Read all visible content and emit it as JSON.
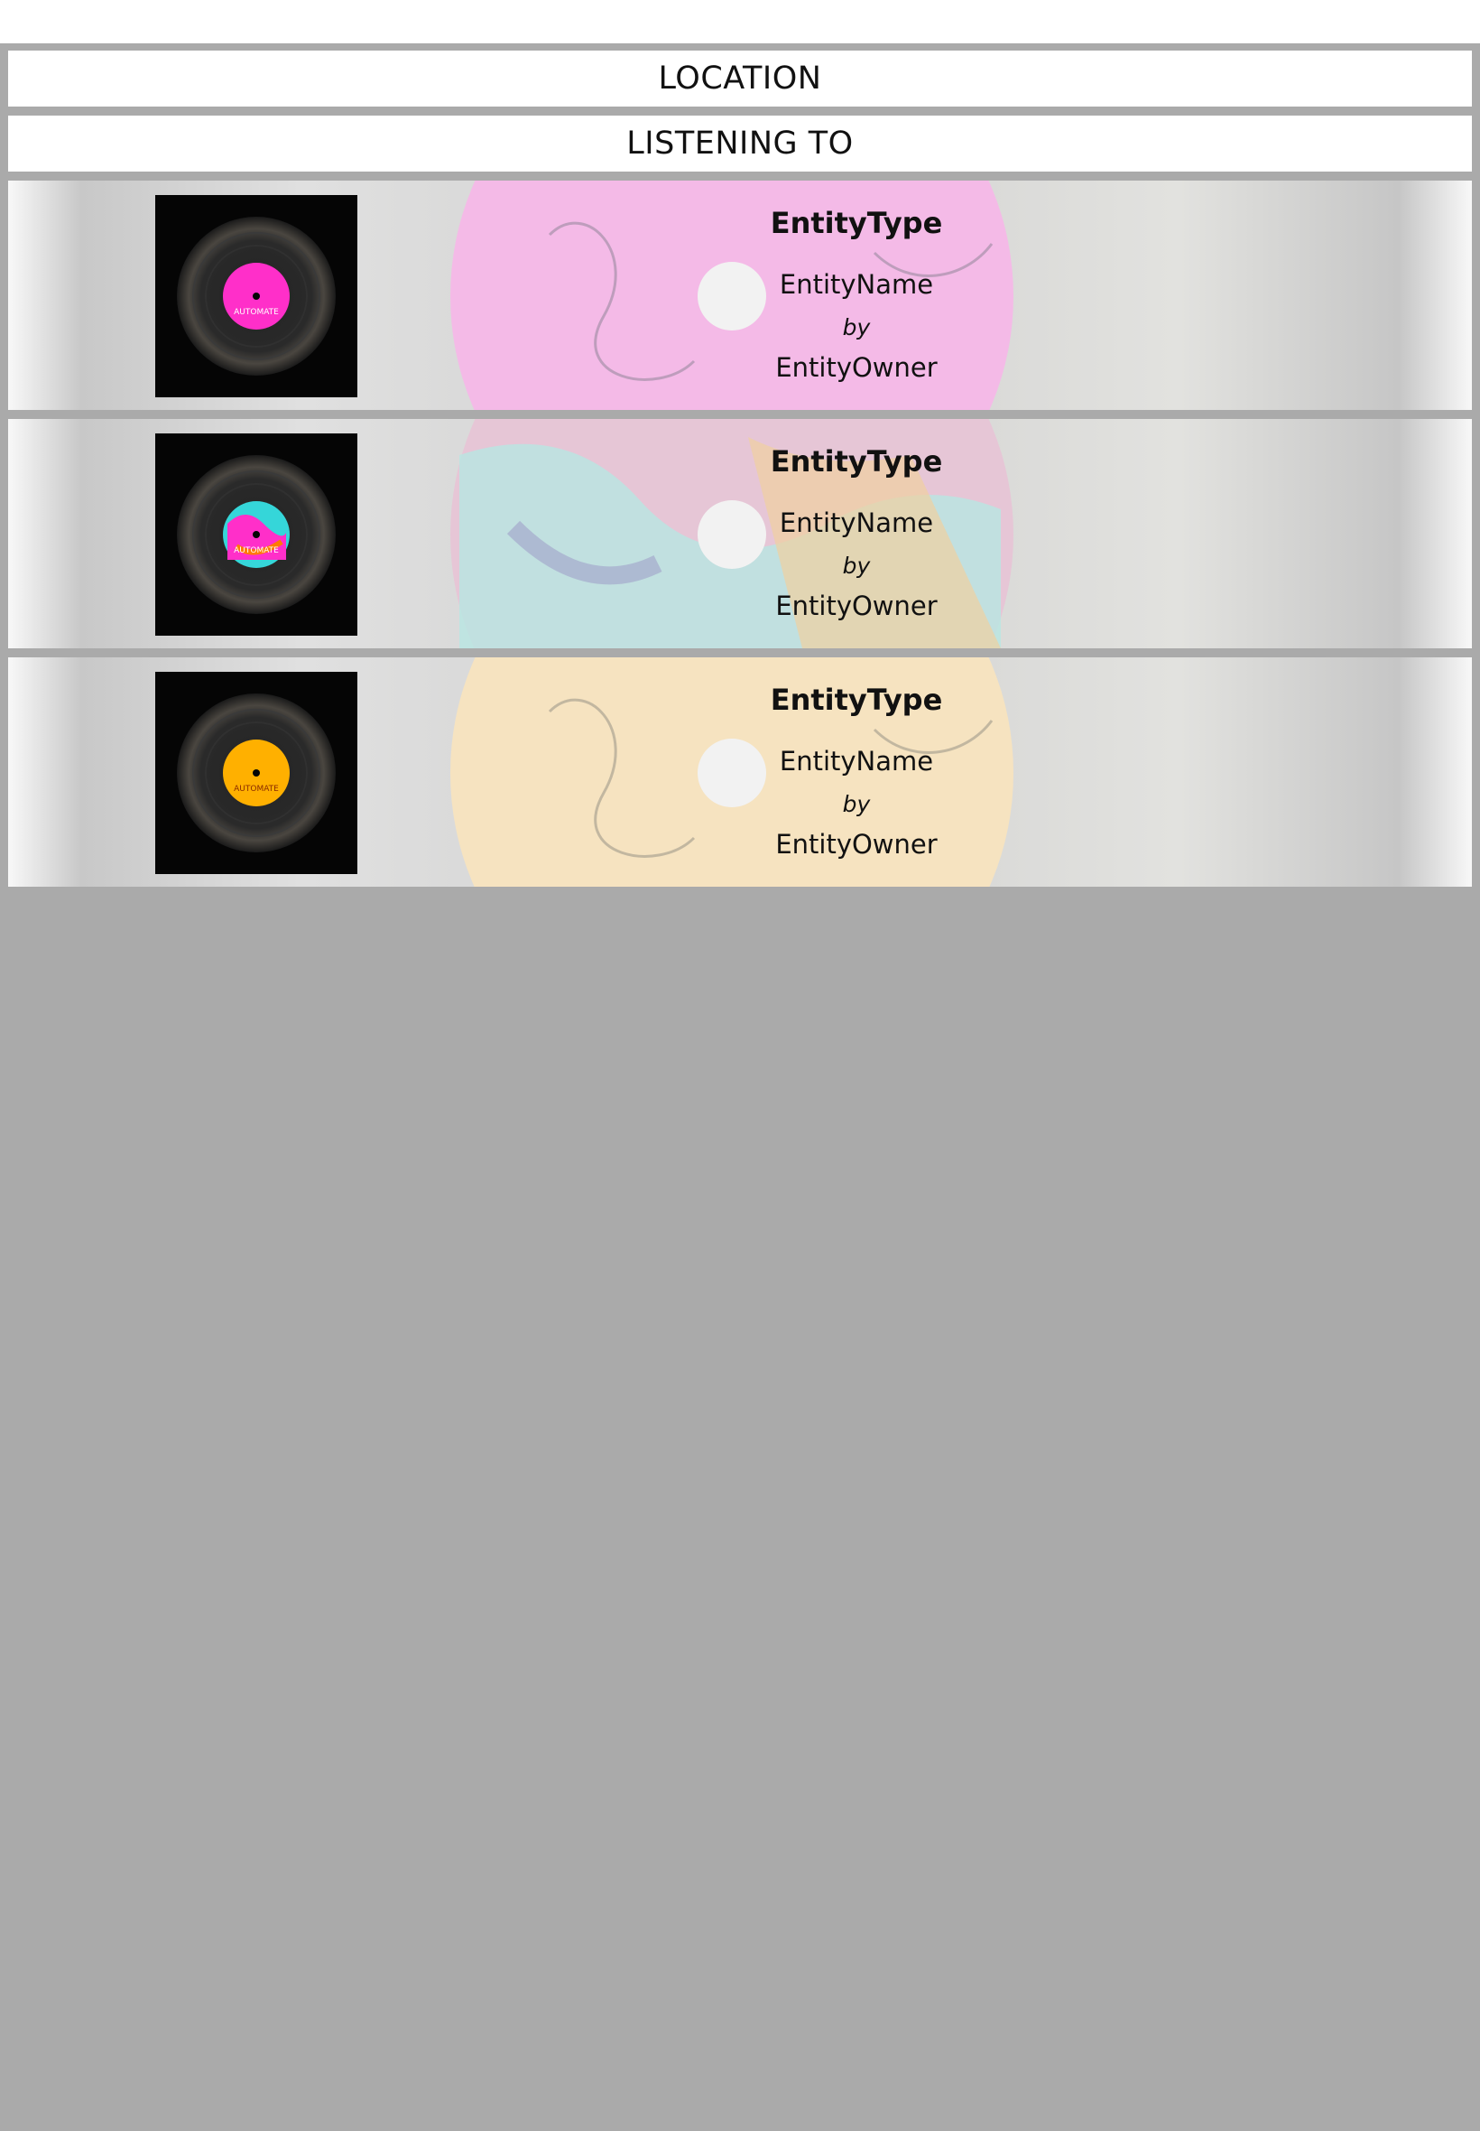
{
  "header": {
    "location": "LOCATION",
    "listening_to": "LISTENING TO"
  },
  "items": [
    {
      "type": "EntityType",
      "name": "EntityName",
      "by": "by",
      "owner": "EntityOwner",
      "label_color": "#ff2fc9",
      "art": "vinyl-record-pink-label",
      "label_text": "AUTOMATE"
    },
    {
      "type": "EntityType",
      "name": "EntityName",
      "by": "by",
      "owner": "EntityOwner",
      "label_color": "#35d6d9",
      "art": "vinyl-record-splatter-label",
      "label_text": "AUTOMATE"
    },
    {
      "type": "EntityType",
      "name": "EntityName",
      "by": "by",
      "owner": "EntityOwner",
      "label_color": "#ffb000",
      "art": "vinyl-record-orange-label",
      "label_text": "AUTOMATE"
    }
  ]
}
